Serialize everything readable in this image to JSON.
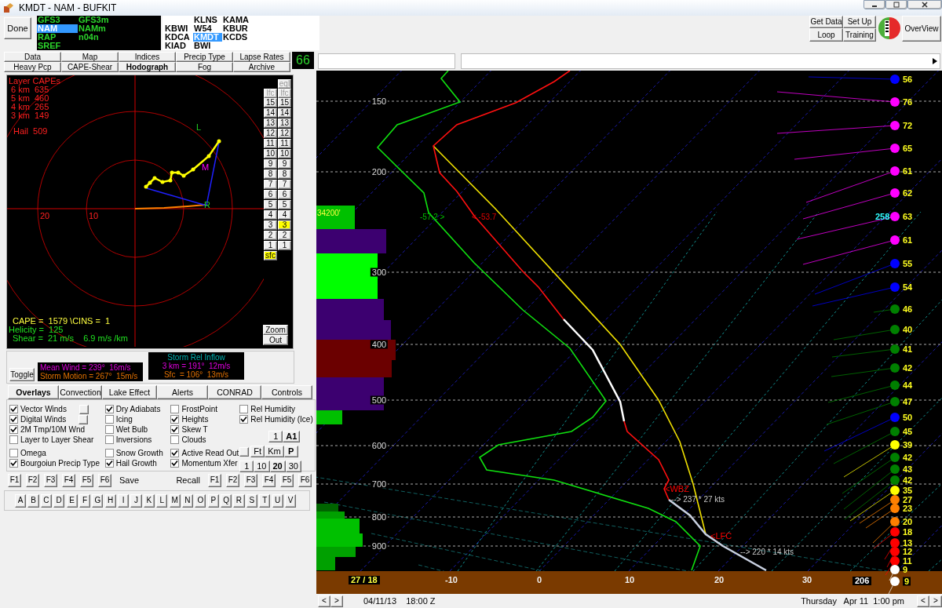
{
  "window": {
    "title": "KMDT - NAM - BUFKIT"
  },
  "done_button": "Done",
  "models": [
    {
      "label": "GFS3",
      "selected": false
    },
    {
      "label": "GFS3m",
      "selected": false
    },
    {
      "label": "NAM",
      "selected": true
    },
    {
      "label": "NAMm",
      "selected": false
    },
    {
      "label": "RAP",
      "selected": false
    },
    {
      "label": "n04n",
      "selected": false
    },
    {
      "label": "SREF",
      "selected": false
    }
  ],
  "station_columns": [
    [
      {
        "label": "KBWI",
        "selected": false
      },
      {
        "label": "KDCA",
        "selected": false
      },
      {
        "label": "KIAD",
        "selected": false
      }
    ],
    [
      {
        "label": "KLNS",
        "selected": false
      },
      {
        "label": "W54",
        "selected": false
      },
      {
        "label": "KMDT",
        "selected": true
      },
      {
        "label": "BWI",
        "selected": false
      }
    ],
    [
      {
        "label": "KAMA",
        "selected": false
      },
      {
        "label": "KBUR",
        "selected": false
      },
      {
        "label": "KCDS",
        "selected": false
      }
    ]
  ],
  "toolbar": [
    "Get Data",
    "Set Up",
    "Loop",
    "Training"
  ],
  "overview_button": "OverView",
  "view_tabs": [
    {
      "label": "Data",
      "selected": false
    },
    {
      "label": "Map",
      "selected": false
    },
    {
      "label": "Indices",
      "selected": false
    },
    {
      "label": "Precip Type",
      "selected": false
    },
    {
      "label": "Lapse Rates",
      "selected": false
    },
    {
      "label": "Heavy Pcp",
      "selected": false
    },
    {
      "label": "CAPE-Shear",
      "selected": false
    },
    {
      "label": "Hodograph",
      "selected": true
    },
    {
      "label": "Fog",
      "selected": false
    },
    {
      "label": "Archive",
      "selected": false
    }
  ],
  "counter": "66",
  "hodograph": {
    "cape_title": "Layer CAPEs",
    "layer_capes": [
      "6 km  635",
      "5 km  460",
      "4 km  265",
      "3 km  149"
    ],
    "hail": "Hail  509",
    "ring_labels": [
      "20",
      "10"
    ],
    "markers": [
      "L",
      "M",
      "R"
    ],
    "cape_line": "CAPE =  1579 \\CINS =  1",
    "helicity": "Helicity =  125",
    "shear": "Shear =  21 m/s    6.9 m/s /km"
  },
  "height_buttons": {
    "eql": "eql",
    "left": [
      {
        "label": "lfc",
        "selected": false
      },
      {
        "label": "15",
        "selected": false
      },
      {
        "label": "14",
        "selected": false
      },
      {
        "label": "13",
        "selected": false
      },
      {
        "label": "12",
        "selected": false
      },
      {
        "label": "11",
        "selected": false
      },
      {
        "label": "10",
        "selected": false
      },
      {
        "label": "9",
        "selected": false
      },
      {
        "label": "8",
        "selected": false
      },
      {
        "label": "7",
        "selected": false
      },
      {
        "label": "6",
        "selected": false
      },
      {
        "label": "5",
        "selected": false
      },
      {
        "label": "4",
        "selected": false
      },
      {
        "label": "3",
        "selected": false
      },
      {
        "label": "2",
        "selected": false
      },
      {
        "label": "1",
        "selected": false
      },
      {
        "label": "sfc",
        "selected": true
      }
    ],
    "right": [
      {
        "label": "lfc",
        "selected": false
      },
      {
        "label": "15",
        "selected": false
      },
      {
        "label": "14",
        "selected": false
      },
      {
        "label": "13",
        "selected": false
      },
      {
        "label": "12",
        "selected": false
      },
      {
        "label": "11",
        "selected": false
      },
      {
        "label": "10",
        "selected": false
      },
      {
        "label": "9",
        "selected": false
      },
      {
        "label": "8",
        "selected": false
      },
      {
        "label": "7",
        "selected": false
      },
      {
        "label": "6",
        "selected": false
      },
      {
        "label": "5",
        "selected": false
      },
      {
        "label": "4",
        "selected": false
      },
      {
        "label": "3",
        "selected": true
      },
      {
        "label": "2",
        "selected": false
      },
      {
        "label": "1",
        "selected": false
      }
    ],
    "zoom": "Zoom",
    "out": "Out"
  },
  "storm": {
    "toggle": "Toggle",
    "mean_wind": "Mean Wind = 239°  16m/s",
    "storm_motion": "Storm Motion = 267°  15m/s",
    "inflow_title": "Storm Rel Inflow",
    "inflow_3km": "3 km = 191°  12m/s",
    "inflow_sfc": "Sfc  = 106°  13m/s"
  },
  "panel_tabs": [
    {
      "label": "Overlays",
      "selected": true
    },
    {
      "label": "Convection",
      "selected": false
    },
    {
      "label": "Lake Effect",
      "selected": false
    },
    {
      "label": "Alerts",
      "selected": false
    },
    {
      "label": "CONRAD",
      "selected": false
    },
    {
      "label": "Controls",
      "selected": false
    }
  ],
  "overlay_columns": [
    [
      {
        "label": "Vector Winds",
        "checked": true,
        "kind": "check-button"
      },
      {
        "label": "Digital Winds",
        "checked": true,
        "kind": "check-button"
      },
      {
        "label": "2M Tmp/10M Wnd",
        "checked": true,
        "kind": "check"
      },
      {
        "label": "Layer to Layer Shear",
        "checked": false,
        "kind": "check"
      },
      {
        "label": "Omega",
        "checked": false,
        "kind": "check"
      },
      {
        "label": "Bourgoiun Precip Type",
        "checked": true,
        "kind": "check"
      }
    ],
    [
      {
        "label": "Dry Adiabats",
        "checked": true,
        "kind": "check"
      },
      {
        "label": "Icing",
        "checked": false,
        "kind": "check"
      },
      {
        "label": "Wet Bulb",
        "checked": false,
        "kind": "check"
      },
      {
        "label": "Inversions",
        "checked": false,
        "kind": "check"
      },
      {
        "label": "Snow Growth",
        "checked": false,
        "kind": "check"
      },
      {
        "label": "Hail Growth",
        "checked": true,
        "kind": "check"
      }
    ],
    [
      {
        "label": "FrostPoint",
        "checked": false,
        "kind": "check"
      },
      {
        "label": "Heights",
        "checked": true,
        "kind": "check"
      },
      {
        "label": "Skew T",
        "checked": true,
        "kind": "check"
      },
      {
        "label": "Clouds",
        "checked": false,
        "kind": "check"
      },
      {
        "label": "Active Read Out",
        "checked": true,
        "kind": "check"
      },
      {
        "label": "Momentum Xfer",
        "checked": true,
        "kind": "check"
      }
    ],
    [
      {
        "label": "Rel Humidity",
        "checked": false,
        "kind": "check"
      },
      {
        "label": "Rel Humidity (Ice)",
        "checked": true,
        "kind": "check"
      }
    ]
  ],
  "unit_buttons": [
    {
      "blank_lead": false,
      "buttons": [
        {
          "label": "1",
          "selected": false
        },
        {
          "label": "A1",
          "selected": true
        }
      ]
    },
    {
      "blank_lead": true,
      "buttons": [
        {
          "label": "Ft",
          "selected": false
        },
        {
          "label": "Km",
          "selected": false
        },
        {
          "label": "P",
          "selected": true
        }
      ]
    },
    {
      "blank_lead": false,
      "buttons": [
        {
          "label": "1",
          "selected": false
        },
        {
          "label": "10",
          "selected": false
        },
        {
          "label": "20",
          "selected": true
        },
        {
          "label": "30",
          "selected": false
        }
      ]
    }
  ],
  "save_keys": [
    "F1",
    "F2",
    "F3",
    "F4",
    "F5",
    "F6"
  ],
  "save_label": "Save",
  "recall_label": "Recall",
  "recall_keys": [
    "F1",
    "F2",
    "F3",
    "F4",
    "F5",
    "F6"
  ],
  "letters": [
    "A",
    "B",
    "C",
    "D",
    "E",
    "F",
    "G",
    "H",
    "I",
    "J",
    "K",
    "L",
    "M",
    "N",
    "O",
    "P",
    "Q",
    "R",
    "S",
    "T",
    "U",
    "V"
  ],
  "skewt": {
    "pressure_labels": [
      "150",
      "200",
      "300",
      "400",
      "500",
      "600",
      "700",
      "800",
      "900"
    ],
    "temp_labels": [
      "-10",
      "0",
      "10",
      "20",
      "30"
    ],
    "height_label": "34200'",
    "annotations": [
      {
        "text": "-57.2 >",
        "color": "#00c000"
      },
      {
        "text": "< -53.7",
        "color": "#e00000"
      },
      {
        "text": "<WBZ",
        "color": "#ff0000"
      },
      {
        "text": "--> 237 * 27 kts",
        "color": "#c8c8c8"
      },
      {
        "text": "<LFC",
        "color": "#ff0000"
      },
      {
        "text": "--> 220 * 14 kts",
        "color": "#c8c8c8"
      }
    ],
    "direction_label": "258",
    "winds": [
      {
        "speed": "56",
        "color": "#0000ff"
      },
      {
        "speed": "76",
        "color": "#ff00ff"
      },
      {
        "speed": "72",
        "color": "#ff00ff"
      },
      {
        "speed": "65",
        "color": "#ff00ff"
      },
      {
        "speed": "61",
        "color": "#ff00ff"
      },
      {
        "speed": "62",
        "color": "#ff00ff"
      },
      {
        "speed": "63",
        "color": "#ff00ff"
      },
      {
        "speed": "61",
        "color": "#ff00ff"
      },
      {
        "speed": "55",
        "color": "#0000ff"
      },
      {
        "speed": "54",
        "color": "#0000ff"
      },
      {
        "speed": "46",
        "color": "#008000"
      },
      {
        "speed": "40",
        "color": "#008000"
      },
      {
        "speed": "41",
        "color": "#008000"
      },
      {
        "speed": "42",
        "color": "#008000"
      },
      {
        "speed": "44",
        "color": "#008000"
      },
      {
        "speed": "47",
        "color": "#008000"
      },
      {
        "speed": "50",
        "color": "#0000ff"
      },
      {
        "speed": "45",
        "color": "#008000"
      },
      {
        "speed": "39",
        "color": "#ffff00"
      },
      {
        "speed": "42",
        "color": "#008000"
      },
      {
        "speed": "43",
        "color": "#008000"
      },
      {
        "speed": "42",
        "color": "#008000"
      },
      {
        "speed": "35",
        "color": "#ffff00"
      },
      {
        "speed": "27",
        "color": "#ff8000"
      },
      {
        "speed": "23",
        "color": "#ff8000"
      },
      {
        "speed": "20",
        "color": "#ff8000"
      },
      {
        "speed": "18",
        "color": "#ff0000"
      },
      {
        "speed": "13",
        "color": "#ff0000"
      },
      {
        "speed": "12",
        "color": "#ff0000"
      },
      {
        "speed": "11",
        "color": "#ff0000"
      },
      {
        "speed": "9",
        "color": "#ffffff"
      },
      {
        "speed": "9",
        "color": "#ffffff"
      }
    ],
    "surface_temps": "27 / 18",
    "readout": "206"
  },
  "status": {
    "left_nav": [
      "<",
      ">"
    ],
    "date": "04/11/13    18:00 Z",
    "local_time": "Thursday   Apr 11  1:00 pm",
    "right_nav": [
      "<",
      ">"
    ]
  }
}
